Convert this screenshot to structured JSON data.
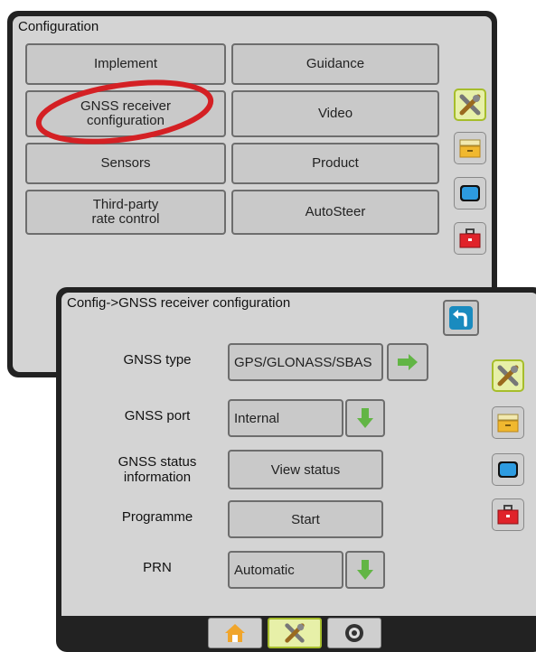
{
  "config_screen": {
    "title": "Configuration",
    "buttons": [
      {
        "label": "Implement"
      },
      {
        "label": "Guidance"
      },
      {
        "label": "GNSS receiver\nconfiguration"
      },
      {
        "label": "Video"
      },
      {
        "label": "Sensors"
      },
      {
        "label": "Product"
      },
      {
        "label": "Third-party\nrate control"
      },
      {
        "label": "AutoSteer"
      }
    ],
    "side_tabs": [
      {
        "icon": "tools-icon",
        "active": true
      },
      {
        "icon": "drawer-icon",
        "active": false
      },
      {
        "icon": "screen-icon",
        "active": false
      },
      {
        "icon": "toolbox-icon",
        "active": false
      }
    ]
  },
  "gnss_screen": {
    "title": "Config->GNSS receiver configuration",
    "rows": [
      {
        "label": "GNSS type",
        "value": "GPS/GLONASS/SBAS",
        "action": "arrow-right-icon"
      },
      {
        "label": "GNSS port",
        "value": "Internal",
        "action": "arrow-down-icon"
      },
      {
        "label": "GNSS status\ninformation",
        "value": "View status",
        "action": ""
      },
      {
        "label": "Programme",
        "value": "Start",
        "action": ""
      },
      {
        "label": "PRN",
        "value": "Automatic",
        "action": "arrow-down-icon"
      }
    ],
    "bottom_tabs": [
      "home-icon",
      "tools-icon",
      "gauge-icon"
    ]
  },
  "colors": {
    "highlight_circle": "#d42024",
    "arrow_green": "#62b545",
    "back_blue": "#1a8bbf"
  }
}
